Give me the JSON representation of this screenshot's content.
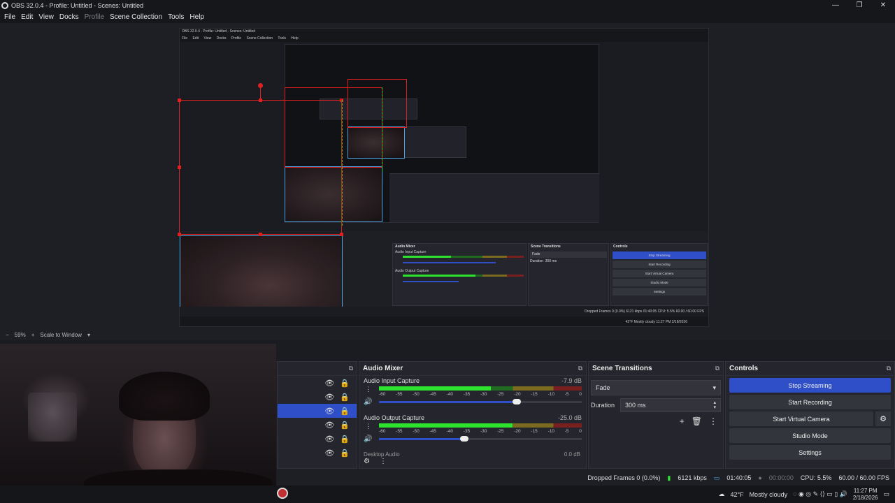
{
  "window": {
    "title": "OBS 32.0.4 - Profile: Untitled - Scenes: Untitled",
    "min": "—",
    "max": "❐",
    "close": "✕"
  },
  "menu": {
    "file": "File",
    "edit": "Edit",
    "view": "View",
    "docks": "Docks",
    "profile": "Profile",
    "scene_collection": "Scene Collection",
    "tools": "Tools",
    "help": "Help"
  },
  "nested": {
    "title": "OBS 32.0.4 - Profile: Untitled - Scenes: Untitled",
    "menu": [
      "File",
      "Edit",
      "View",
      "Docks",
      "Profile",
      "Scene Collection",
      "Tools",
      "Help"
    ],
    "zoom": "59%",
    "scale": "Scale to Window",
    "mixer_title": "Audio Mixer",
    "input_label": "Audio Input Capture",
    "input_db": "-7.9 dB",
    "output_label": "Audio Output Capture",
    "output_db": "-25.0 dB",
    "trans_title": "Scene Transitions",
    "trans_value": "Fade",
    "duration_label": "Duration",
    "duration_value": "300 ms",
    "ctrl_title": "Controls",
    "stop_streaming": "Stop Streaming",
    "start_recording": "Start Recording",
    "start_virtual_camera": "Start Virtual Camera",
    "studio_mode": "Studio Mode",
    "settings": "Settings",
    "status": "Dropped Frames 0 (0.0%)   6121 kbps   01:40:05   CPU: 5.5%   60.00 / 60.00 FPS",
    "task": "42°F  Mostly cloudy   11:27 PM  2/18/2026"
  },
  "preview": {
    "zoom": "59%",
    "scale_mode": "Scale to Window"
  },
  "mixer": {
    "title": "Audio Mixer",
    "scale": [
      "-60",
      "-55",
      "-50",
      "-45",
      "-40",
      "-35",
      "-30",
      "-25",
      "-20",
      "-15",
      "-10",
      "-5",
      "0"
    ],
    "tracks": [
      {
        "name": "Audio Input Capture",
        "db": "-7.9 dB",
        "level": 0.55,
        "volume": 0.68
      },
      {
        "name": "Audio Output Capture",
        "db": "-25.0 dB",
        "level": 0.66,
        "volume": 0.42
      }
    ],
    "third_track": "Desktop Audio",
    "third_db": "0.0 dB"
  },
  "transitions": {
    "title": "Scene Transitions",
    "selected": "Fade",
    "duration_label": "Duration",
    "duration_value": "300 ms"
  },
  "controls": {
    "title": "Controls",
    "stop_streaming": "Stop Streaming",
    "start_recording": "Start Recording",
    "start_virtual_camera": "Start Virtual Camera",
    "studio_mode": "Studio Mode",
    "settings": "Settings"
  },
  "status": {
    "dropped": "Dropped Frames 0 (0.0%)",
    "bitrate": "6121 kbps",
    "stream_time": "01:40:05",
    "rec_time": "00:00:00",
    "cpu": "CPU: 5.5%",
    "fps": "60.00 / 60.00 FPS"
  },
  "taskbar": {
    "weather_temp": "42°F",
    "weather_text": "Mostly cloudy",
    "time": "11:27 PM",
    "date": "2/18/2026"
  },
  "colors": {
    "accent": "#2f4fc8",
    "selection": "#e02020",
    "guide": "#21d321"
  }
}
